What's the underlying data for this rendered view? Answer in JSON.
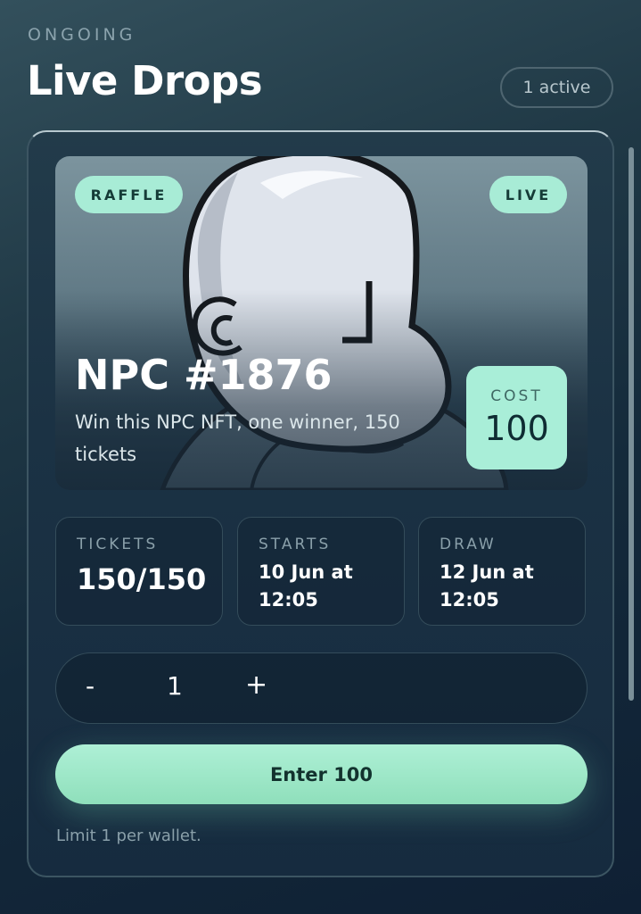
{
  "header": {
    "eyebrow": "ONGOING",
    "title": "Live Drops",
    "active_count": "1 active"
  },
  "drop": {
    "type_tag": "RAFFLE",
    "status_tag": "LIVE",
    "title": "NPC #1876",
    "description": "Win this NPC NFT, one winner, 150 tickets",
    "cost_label": "COST",
    "cost_value": "100",
    "image_icon": "npc-character-image",
    "stats": {
      "tickets_label": "TICKETS",
      "tickets_value": "150/150",
      "starts_label": "STARTS",
      "starts_value": "10 Jun at 12:05",
      "draw_label": "DRAW",
      "draw_value": "12 Jun at 12:05"
    },
    "quantity": {
      "minus": "-",
      "value": "1",
      "plus": "+"
    },
    "enter_label": "Enter 100",
    "limit_text": "Limit 1 per wallet."
  },
  "colors": {
    "accent": "#a8ecd6",
    "button": "#9ae6c6",
    "background": "#142a3b",
    "card": "#1b3244"
  }
}
